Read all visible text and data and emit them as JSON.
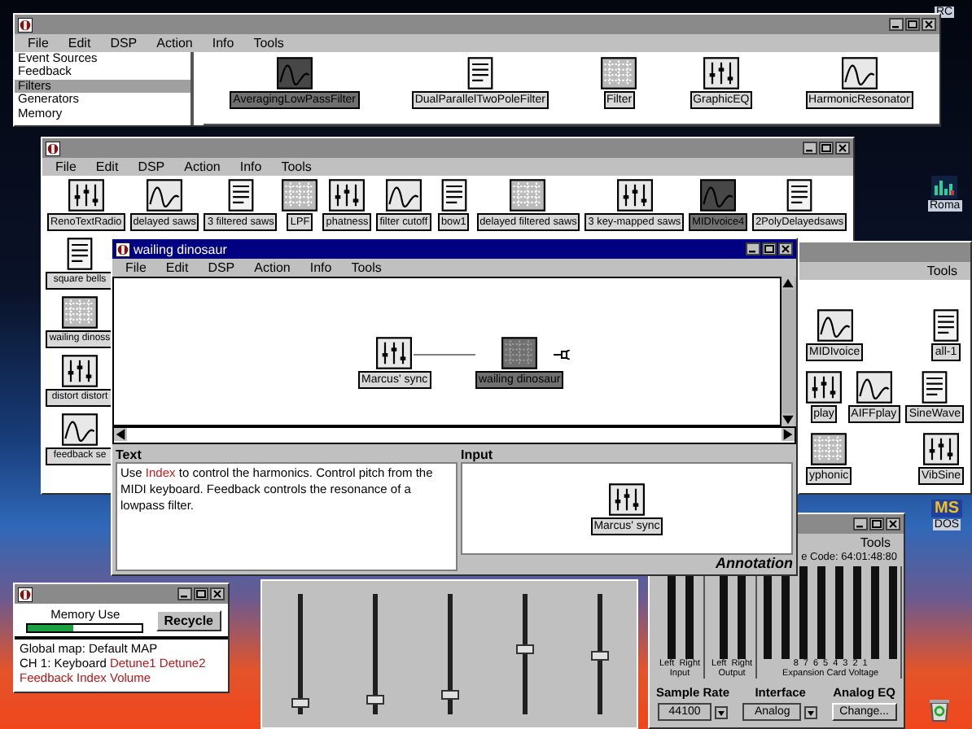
{
  "library_window": {
    "menu": [
      "File",
      "Edit",
      "DSP",
      "Action",
      "Info",
      "Tools"
    ],
    "categories": [
      {
        "label": "Event Sources",
        "selected": false
      },
      {
        "label": "Feedback",
        "selected": false
      },
      {
        "label": "Filters",
        "selected": true
      },
      {
        "label": "Generators",
        "selected": false
      },
      {
        "label": "Memory",
        "selected": false
      }
    ],
    "modules": [
      {
        "label": "AveragingLowPassFilter",
        "selected": true
      },
      {
        "label": "DualParallelTwoPoleFilter",
        "selected": false
      },
      {
        "label": "Filter",
        "selected": false
      },
      {
        "label": "GraphicEQ",
        "selected": false
      },
      {
        "label": "HarmonicResonator",
        "selected": false
      }
    ]
  },
  "patch_window": {
    "menu": [
      "File",
      "Edit",
      "DSP",
      "Action",
      "Info",
      "Tools"
    ],
    "patches": [
      {
        "label": "RenoTextRadio",
        "selected": false
      },
      {
        "label": "delayed saws",
        "selected": false
      },
      {
        "label": "3 filtered saws",
        "selected": false
      },
      {
        "label": "LPF",
        "selected": false
      },
      {
        "label": "phatness",
        "selected": false
      },
      {
        "label": "filter cutoff",
        "selected": false
      },
      {
        "label": "bow1",
        "selected": false
      },
      {
        "label": "delayed filtered saws",
        "selected": false
      },
      {
        "label": "3 key-mapped saws",
        "selected": false
      },
      {
        "label": "MIDIvoice4",
        "selected": true
      },
      {
        "label": "2PolyDelayedsaws",
        "selected": false
      }
    ],
    "column": [
      "square bells",
      "wailing dinoss",
      "distort distort",
      "feedback se"
    ]
  },
  "back_window": {
    "menu": [
      "Tools"
    ],
    "rows": [
      [
        "MIDIvoice",
        "all-1"
      ],
      [
        "play",
        "AIFFplay",
        "SineWave"
      ],
      [
        "yphonic",
        "VibSine"
      ]
    ]
  },
  "editor_window": {
    "title": "wailing dinosaur",
    "menu": [
      "File",
      "Edit",
      "DSP",
      "Action",
      "Info",
      "Tools"
    ],
    "nodes": [
      {
        "label": "Marcus' sync",
        "selected": false
      },
      {
        "label": "wailing dinosaur",
        "selected": true
      }
    ],
    "text_heading": "Text",
    "text_body": "Use **Index** to control the harmonics.  Control pitch from the MIDI keyboard.  Feedback controls the resonance of a lowpass filter.",
    "input_heading": "Input",
    "input_node": "Marcus' sync",
    "annotation": "Annotation"
  },
  "sliders": [
    {
      "level": 0.05
    },
    {
      "level": 0.08
    },
    {
      "level": 0.12
    },
    {
      "level": 0.5
    },
    {
      "level": 0.45
    }
  ],
  "memory_window": {
    "heading": "Memory Use",
    "level": 0.4,
    "button": "Recycle",
    "lines": [
      "Global map: Default MAP",
      "CH 1: Keyboard **Detune1** **Detune2**",
      "**Feedback** **Index** **Volume**"
    ]
  },
  "audio_window": {
    "menu": [
      "Tools"
    ],
    "timecode": "e Code: 64:01:48:80",
    "groups": [
      {
        "channels": [
          "Left",
          "Right"
        ],
        "label": "Input"
      },
      {
        "channels": [
          "Left",
          "Right"
        ],
        "label": "Output"
      },
      {
        "channels": [
          "8",
          "7",
          "6",
          "5",
          "4",
          "3",
          "2",
          "1"
        ],
        "label": "Expansion Card Voltage"
      }
    ],
    "sample_rate": {
      "label": "Sample Rate",
      "value": "44100"
    },
    "interface": {
      "label": "Interface",
      "value": "Analog"
    },
    "eq": {
      "label": "Analog EQ",
      "button": "Change..."
    }
  },
  "desktop_icons": [
    {
      "label": "RC"
    },
    {
      "label": "Roma"
    },
    {
      "label": "DOS",
      "logo": "MS"
    }
  ]
}
